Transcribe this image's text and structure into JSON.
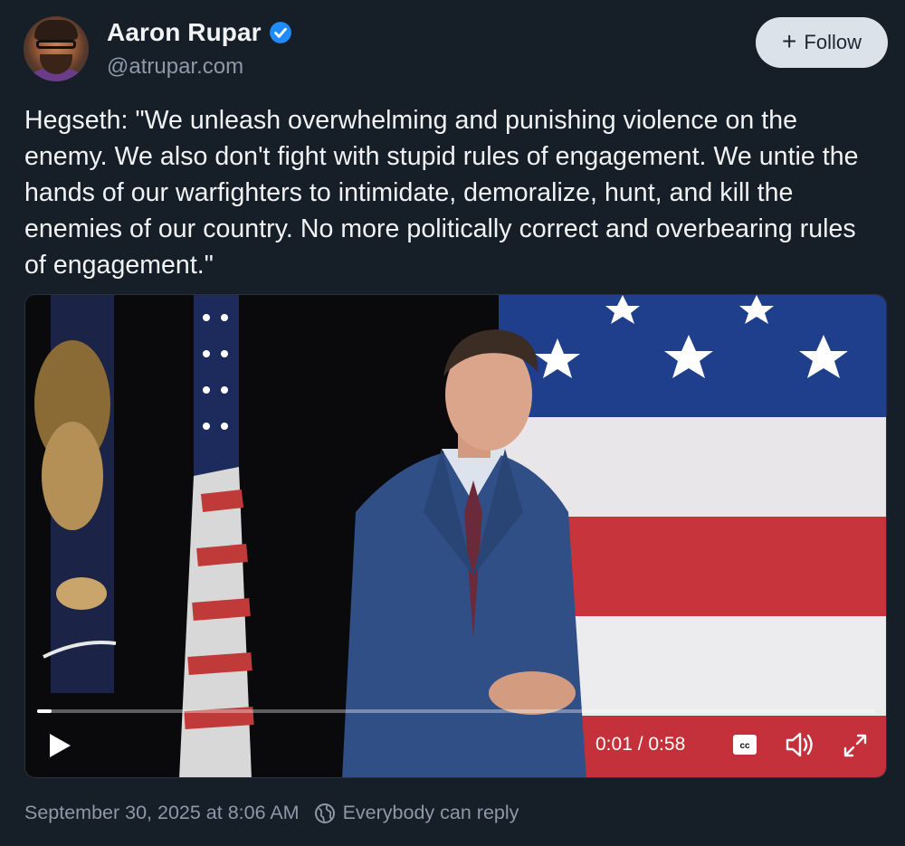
{
  "author": {
    "name": "Aaron Rupar",
    "handle": "@atrupar.com",
    "verified": true
  },
  "follow_button": {
    "label": "Follow",
    "icon": "plus-icon"
  },
  "post": {
    "text": "Hegseth: \"We unleash overwhelming and punishing violence on the enemy. We also don't fight with stupid rules of engagement. We untie the hands of our warfighters to intimidate, demoralize, hunt, and kill the enemies of our country. No more politically correct and overbearing rules of engagement.\""
  },
  "video": {
    "time_display": "0:01 / 0:58",
    "progress_fraction": 0.017,
    "controls": {
      "play": "play-icon",
      "captions": "cc-icon",
      "volume": "volume-icon",
      "fullscreen": "fullscreen-icon"
    }
  },
  "footer": {
    "timestamp": "September 30, 2025 at 8:06 AM",
    "reply_setting": "Everybody can reply",
    "reply_icon": "globe-icon"
  },
  "colors": {
    "background": "#161e27",
    "accent": "#208bfe",
    "text_primary": "#f1f3f5",
    "text_secondary": "#8d99a8",
    "follow_button_bg": "#dbe2ea"
  }
}
